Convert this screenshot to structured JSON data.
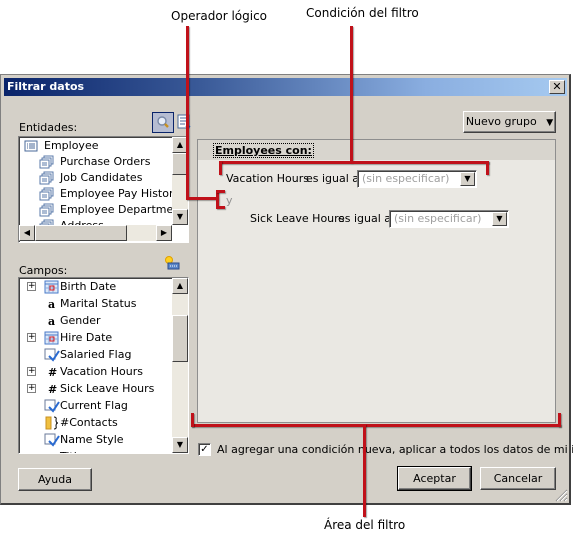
{
  "callouts": {
    "logical_operator": "Operador lógico",
    "filter_condition": "Condición del filtro",
    "filter_area": "Área del filtro"
  },
  "dialog": {
    "title": "Filtrar datos",
    "close_glyph": "✕"
  },
  "entities": {
    "label": "Entidades:",
    "items": [
      {
        "label": "Employee",
        "icon": "entity-icon",
        "selected": true
      },
      {
        "label": "Purchase Orders",
        "icon": "related-entity-icon"
      },
      {
        "label": "Job Candidates",
        "icon": "related-entity-icon"
      },
      {
        "label": "Employee Pay Histories",
        "icon": "related-entity-icon"
      },
      {
        "label": "Employee Department",
        "icon": "related-entity-icon"
      },
      {
        "label": "Address",
        "icon": "related-entity-icon"
      }
    ]
  },
  "fields": {
    "label": "Campos:",
    "items": [
      {
        "label": "Birth Date",
        "icon": "date-icon",
        "expandable": true
      },
      {
        "label": "Marital Status",
        "icon": "text-field-icon",
        "glyph": "a",
        "expandable": false
      },
      {
        "label": "Gender",
        "icon": "text-field-icon",
        "glyph": "a",
        "expandable": false
      },
      {
        "label": "Hire Date",
        "icon": "date-icon",
        "expandable": true
      },
      {
        "label": "Salaried Flag",
        "icon": "boolean-icon",
        "expandable": false
      },
      {
        "label": "Vacation Hours",
        "icon": "number-icon",
        "glyph": "#",
        "expandable": true
      },
      {
        "label": "Sick Leave Hours",
        "icon": "number-icon",
        "glyph": "#",
        "expandable": true
      },
      {
        "label": "Current Flag",
        "icon": "boolean-icon",
        "expandable": false
      },
      {
        "label": "#Contacts",
        "icon": "aggregate-icon",
        "expandable": false
      },
      {
        "label": "Name Style",
        "icon": "boolean-icon",
        "expandable": false
      },
      {
        "label": "Title",
        "icon": "text-field-icon",
        "glyph": "a",
        "expandable": false
      }
    ]
  },
  "toolbar": {
    "new_group_label": "Nuevo grupo",
    "dropdown_glyph": "▼"
  },
  "filter": {
    "header": "Employees con:",
    "operator": "y",
    "conditions": [
      {
        "field": "Vacation Hours",
        "operator": "es igual a",
        "value": "(sin especificar)"
      },
      {
        "field": "Sick Leave Hours",
        "operator": "es igual a",
        "value": "(sin especificar)"
      }
    ]
  },
  "options": {
    "apply_all_label": "Al agregar una condición nueva, aplicar a todos los datos de mi informe",
    "apply_all_checked": true
  },
  "buttons": {
    "help": "Ayuda",
    "ok": "Aceptar",
    "cancel": "Cancelar"
  }
}
